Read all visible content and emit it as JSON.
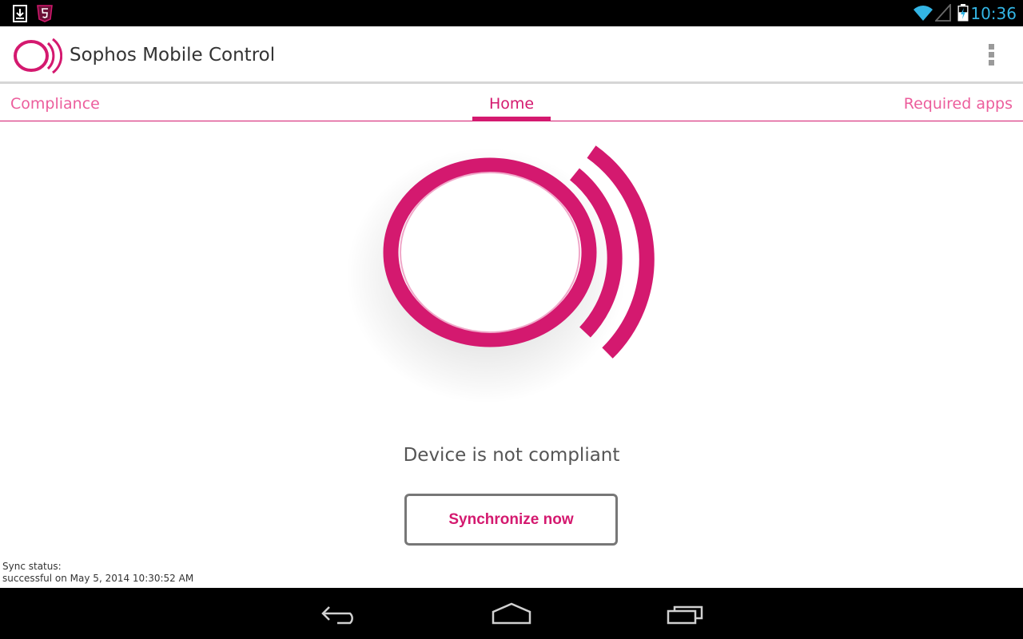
{
  "status_bar": {
    "time": "10:36",
    "icons": [
      "download-notification-icon",
      "html5-shield-icon",
      "wifi-icon",
      "cell-signal-icon",
      "battery-charging-icon"
    ]
  },
  "action_bar": {
    "title": "Sophos Mobile Control",
    "logo": "sophos-logo-icon",
    "overflow": "overflow-menu-icon"
  },
  "tabs": [
    {
      "label": "Compliance",
      "selected": false
    },
    {
      "label": "Home",
      "selected": true
    },
    {
      "label": "Required apps",
      "selected": false
    }
  ],
  "main": {
    "status_message": "Device is not compliant",
    "sync_button_label": "Synchronize now",
    "sync_status_label": "Sync status:",
    "sync_status_value": "successful on May 5, 2014 10:30:52 AM"
  },
  "nav_bar": {
    "icons": [
      "back-icon",
      "home-icon",
      "recents-icon"
    ]
  },
  "colors": {
    "accent": "#d4196f",
    "tab_inactive": "#ec5d9c",
    "clock": "#33b5e5"
  }
}
